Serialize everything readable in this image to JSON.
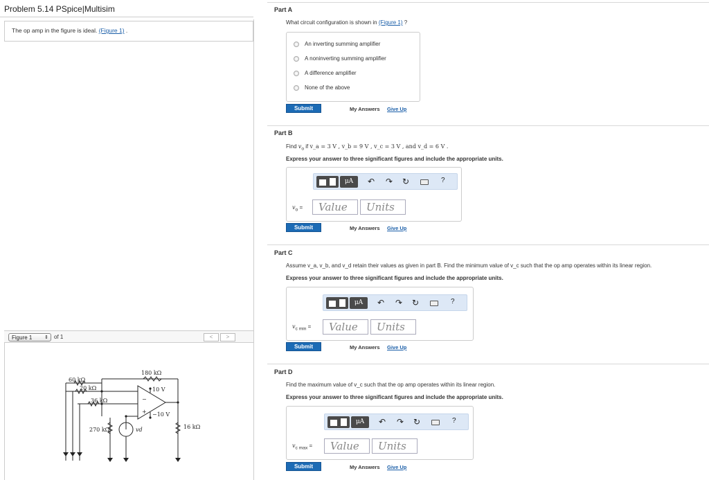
{
  "problem": {
    "title": "Problem 5.14 PSpice|Multisim",
    "statement": "The op amp in the figure is ideal.",
    "figure_link": "(Figure 1)",
    "trailing": "."
  },
  "figure": {
    "selected": "Figure 1",
    "of_label": "of 1",
    "prev": "<",
    "next": ">",
    "labels": {
      "r60": "60 kΩ",
      "r180": "180 kΩ",
      "r20": "20 kΩ",
      "r36": "36 kΩ",
      "v10p": "10 V",
      "v10n": "−10 V",
      "r270": "270 kΩ",
      "r16": "16 kΩ",
      "vd": "vd",
      "minus_sign": "−",
      "plus_sign": "+"
    }
  },
  "partA": {
    "title": "Part A",
    "question": "What circuit configuration is shown in",
    "figure_link": "(Figure 1)",
    "question_end": "?",
    "choices": [
      "An inverting summing amplifier",
      "A noninverting summing amplifier",
      "A difference amplifier",
      "None of the above"
    ],
    "submit": "Submit",
    "my_answers": "My Answers",
    "give_up": "Give Up"
  },
  "partB": {
    "title": "Part B",
    "question_prefix": "Find",
    "vo": "v",
    "vo_sub": "o",
    "question_if": "if",
    "values": "v_a = 3 V , v_b = 9 V , v_c = 3 V , and v_d = 6 V .",
    "instruction": "Express your answer to three significant figures and include the appropriate units.",
    "answer_label": "v",
    "answer_label_sub": "o",
    "answer_equals": "=",
    "value_placeholder": "Value",
    "units_placeholder": "Units",
    "submit": "Submit",
    "my_answers": "My Answers",
    "give_up": "Give Up"
  },
  "partC": {
    "title": "Part C",
    "question": "Assume v_a, v_b, and v_d retain their values as given in part B. Find the minimum value of v_c such that the op amp operates within its linear region.",
    "instruction": "Express your answer to three significant figures and include the appropriate units.",
    "answer_label": "v",
    "answer_label_sub": "c min",
    "answer_equals": "=",
    "value_placeholder": "Value",
    "units_placeholder": "Units",
    "submit": "Submit",
    "my_answers": "My Answers",
    "give_up": "Give Up"
  },
  "partD": {
    "title": "Part D",
    "question": "Find the maximum value of v_c such that the op amp operates within its linear region.",
    "instruction": "Express your answer to three significant figures and include the appropriate units.",
    "answer_label": "v",
    "answer_label_sub": "c max",
    "answer_equals": "=",
    "value_placeholder": "Value",
    "units_placeholder": "Units",
    "submit": "Submit",
    "my_answers": "My Answers",
    "give_up": "Give Up"
  },
  "toolbar": {
    "mu_label": "μA",
    "undo_icon": "undo-icon",
    "redo_icon": "redo-icon",
    "reset_icon": "reset-icon",
    "keyboard_icon": "keyboard-icon",
    "help": "?"
  },
  "colors": {
    "accent": "#1c6bb5",
    "link": "#1a5ea8",
    "toolbar_bg": "#dde8f6"
  }
}
